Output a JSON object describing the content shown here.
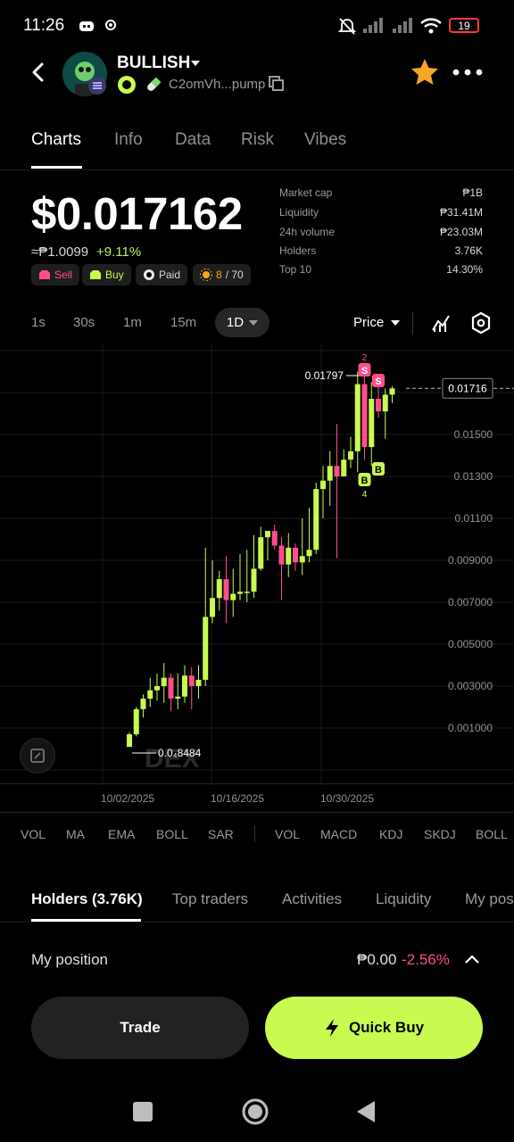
{
  "status": {
    "time": "11:26",
    "battery": "19"
  },
  "header": {
    "token_name": "BULLISH",
    "address": "C2omVh...pump"
  },
  "tabs": [
    "Charts",
    "Info",
    "Data",
    "Risk",
    "Vibes"
  ],
  "price": {
    "value": "$0.017162",
    "native": "≈₱1.0099",
    "change": "+9.11%"
  },
  "badges": {
    "sell": "Sell",
    "buy": "Buy",
    "paid": "Paid",
    "score": "8",
    "score_total": "/ 70"
  },
  "stats": [
    {
      "label": "Market cap",
      "value": "₱1B"
    },
    {
      "label": "Liquidity",
      "value": "₱31.41M"
    },
    {
      "label": "24h volume",
      "value": "₱23.03M"
    },
    {
      "label": "Holders",
      "value": "3.76K"
    },
    {
      "label": "Top 10",
      "value": "14.30%"
    }
  ],
  "timeframes": [
    "1s",
    "30s",
    "1m",
    "15m"
  ],
  "selected_timeframe": "1D",
  "price_mode": "Price",
  "chart_data": {
    "type": "candlestick",
    "y_ticks": [
      "0.01500",
      "0.01300",
      "0.01100",
      "0.009000",
      "0.007000",
      "0.005000",
      "0.003000",
      "0.001000"
    ],
    "x_ticks": [
      "10/02/2025",
      "10/16/2025",
      "10/30/2025"
    ],
    "current_price_label": "0.01716",
    "high_label": "0.01797",
    "low_label": "0.0₄8484",
    "watermark": "DEX",
    "candles": [
      {
        "o": 0.0001,
        "h": 0.0008,
        "l": 0.0001,
        "c": 0.0007
      },
      {
        "o": 0.0007,
        "h": 0.002,
        "l": 0.0006,
        "c": 0.0019
      },
      {
        "o": 0.0019,
        "h": 0.0026,
        "l": 0.0015,
        "c": 0.0024
      },
      {
        "o": 0.0024,
        "h": 0.0034,
        "l": 0.002,
        "c": 0.0028
      },
      {
        "o": 0.0028,
        "h": 0.0036,
        "l": 0.0023,
        "c": 0.003
      },
      {
        "o": 0.003,
        "h": 0.0041,
        "l": 0.0022,
        "c": 0.0034
      },
      {
        "o": 0.0034,
        "h": 0.0036,
        "l": 0.0018,
        "c": 0.0024
      },
      {
        "o": 0.0024,
        "h": 0.0036,
        "l": 0.0019,
        "c": 0.0025
      },
      {
        "o": 0.0025,
        "h": 0.004,
        "l": 0.0022,
        "c": 0.0035
      },
      {
        "o": 0.0035,
        "h": 0.0039,
        "l": 0.0019,
        "c": 0.003
      },
      {
        "o": 0.003,
        "h": 0.004,
        "l": 0.0024,
        "c": 0.0033
      },
      {
        "o": 0.0033,
        "h": 0.0096,
        "l": 0.003,
        "c": 0.0063
      },
      {
        "o": 0.0063,
        "h": 0.009,
        "l": 0.006,
        "c": 0.0072
      },
      {
        "o": 0.0072,
        "h": 0.0085,
        "l": 0.0066,
        "c": 0.0081
      },
      {
        "o": 0.0081,
        "h": 0.0092,
        "l": 0.006,
        "c": 0.0071
      },
      {
        "o": 0.0071,
        "h": 0.0086,
        "l": 0.0063,
        "c": 0.0074
      },
      {
        "o": 0.0074,
        "h": 0.0093,
        "l": 0.0071,
        "c": 0.0075
      },
      {
        "o": 0.0075,
        "h": 0.0095,
        "l": 0.007,
        "c": 0.0075
      },
      {
        "o": 0.0075,
        "h": 0.0102,
        "l": 0.0072,
        "c": 0.0086
      },
      {
        "o": 0.0086,
        "h": 0.0106,
        "l": 0.0085,
        "c": 0.0101
      },
      {
        "o": 0.0101,
        "h": 0.0104,
        "l": 0.009,
        "c": 0.0104
      },
      {
        "o": 0.0104,
        "h": 0.0107,
        "l": 0.0095,
        "c": 0.0097
      },
      {
        "o": 0.0097,
        "h": 0.0101,
        "l": 0.0071,
        "c": 0.0088
      },
      {
        "o": 0.0088,
        "h": 0.0103,
        "l": 0.0082,
        "c": 0.0096
      },
      {
        "o": 0.0096,
        "h": 0.0098,
        "l": 0.0085,
        "c": 0.0089
      },
      {
        "o": 0.0089,
        "h": 0.011,
        "l": 0.0083,
        "c": 0.0092
      },
      {
        "o": 0.0092,
        "h": 0.0115,
        "l": 0.0089,
        "c": 0.0095
      },
      {
        "o": 0.0095,
        "h": 0.0127,
        "l": 0.0093,
        "c": 0.0124
      },
      {
        "o": 0.0124,
        "h": 0.0135,
        "l": 0.011,
        "c": 0.0128
      },
      {
        "o": 0.0128,
        "h": 0.0142,
        "l": 0.0116,
        "c": 0.0135
      },
      {
        "o": 0.0135,
        "h": 0.0155,
        "l": 0.0091,
        "c": 0.013
      },
      {
        "o": 0.013,
        "h": 0.0143,
        "l": 0.013,
        "c": 0.0138
      },
      {
        "o": 0.0138,
        "h": 0.0149,
        "l": 0.0134,
        "c": 0.0142
      },
      {
        "o": 0.0142,
        "h": 0.018,
        "l": 0.0132,
        "c": 0.0174
      },
      {
        "o": 0.0174,
        "h": 0.018,
        "l": 0.0138,
        "c": 0.0144
      },
      {
        "o": 0.0144,
        "h": 0.0175,
        "l": 0.0135,
        "c": 0.0167
      },
      {
        "o": 0.0167,
        "h": 0.0175,
        "l": 0.0158,
        "c": 0.0161
      },
      {
        "o": 0.0161,
        "h": 0.0172,
        "l": 0.0148,
        "c": 0.0169
      },
      {
        "o": 0.0169,
        "h": 0.0173,
        "l": 0.0165,
        "c": 0.0172
      }
    ],
    "sell_markers": [
      {
        "index": 34,
        "label": "S",
        "count": "2"
      },
      {
        "index": 36,
        "label": "S",
        "count": ""
      }
    ],
    "buy_markers": [
      {
        "index": 34,
        "label": "B",
        "count": "4"
      },
      {
        "index": 36,
        "label": "B",
        "count": ""
      }
    ]
  },
  "indicators_left": [
    "VOL",
    "MA",
    "EMA",
    "BOLL",
    "SAR"
  ],
  "indicators_right": [
    "VOL",
    "MACD",
    "KDJ",
    "SKDJ",
    "BOLL"
  ],
  "bottom_tabs": [
    "Holders (3.76K)",
    "Top traders",
    "Activities",
    "Liquidity",
    "My pos"
  ],
  "my_position": {
    "label": "My position",
    "value": "₱0.00",
    "change": "-2.56%"
  },
  "actions": {
    "trade": "Trade",
    "quick_buy": "Quick Buy"
  },
  "colors": {
    "accent": "#c8fa4f",
    "up": "#c8fa4f",
    "down": "#ff4d8d",
    "star": "#f5a623"
  }
}
